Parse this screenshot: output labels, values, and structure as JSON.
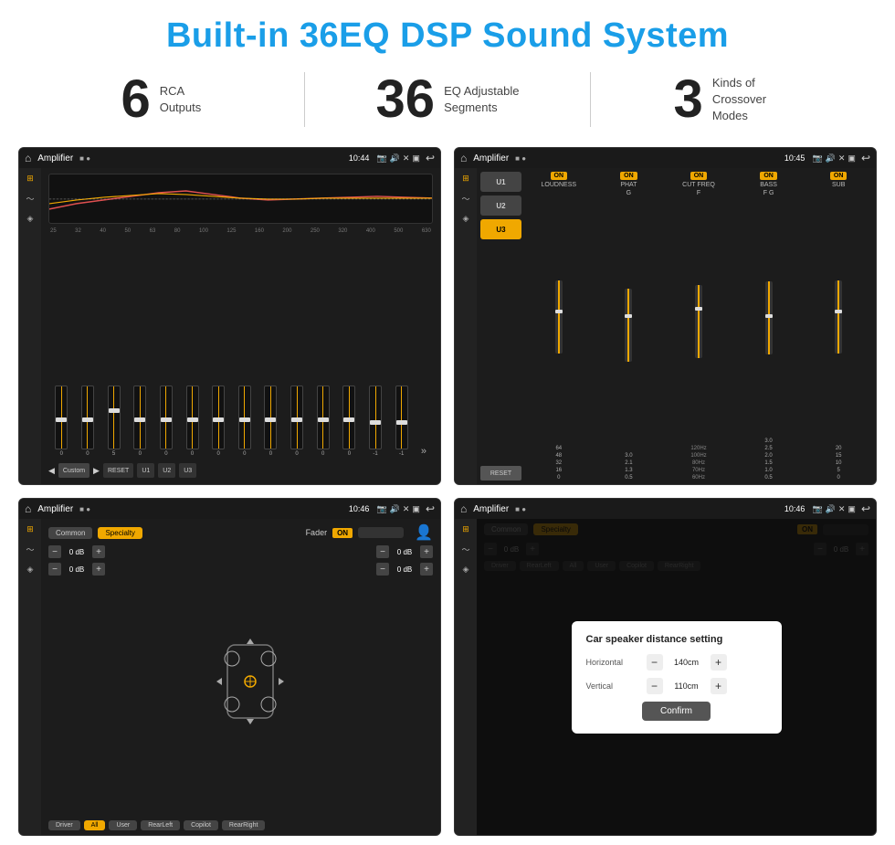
{
  "page": {
    "title": "Built-in 36EQ DSP Sound System",
    "stats": [
      {
        "number": "6",
        "label": "RCA\nOutputs"
      },
      {
        "number": "36",
        "label": "EQ Adjustable\nSegments"
      },
      {
        "number": "3",
        "label": "Kinds of\nCrossover Modes"
      }
    ]
  },
  "screen1": {
    "status_bar": {
      "app": "Amplifier",
      "time": "10:44"
    },
    "eq": {
      "freqs": [
        "25",
        "32",
        "40",
        "50",
        "63",
        "80",
        "100",
        "125",
        "160",
        "200",
        "250",
        "320",
        "400",
        "500",
        "630"
      ],
      "sliders": [
        0,
        0,
        5,
        0,
        0,
        0,
        0,
        0,
        0,
        0,
        0,
        0,
        -1,
        -1
      ],
      "preset": "Custom",
      "buttons": [
        "RESET",
        "U1",
        "U2",
        "U3"
      ]
    }
  },
  "screen2": {
    "status_bar": {
      "app": "Amplifier",
      "time": "10:45"
    },
    "crossover": {
      "u_buttons": [
        "U1",
        "U2",
        "U3"
      ],
      "active": "U3",
      "cols": [
        {
          "label": "LOUDNESS",
          "on": true,
          "g_label": ""
        },
        {
          "label": "PHAT",
          "on": true,
          "g_label": "G"
        },
        {
          "label": "CUT FREQ",
          "on": true,
          "g_label": "F"
        },
        {
          "label": "BASS",
          "on": true,
          "g_label": "F G"
        },
        {
          "label": "SUB",
          "on": true,
          "g_label": ""
        }
      ]
    }
  },
  "screen3": {
    "status_bar": {
      "app": "Amplifier",
      "time": "10:46"
    },
    "fader": {
      "tabs": [
        "Common",
        "Specialty"
      ],
      "active_tab": "Specialty",
      "fader_label": "Fader",
      "on": true,
      "volumes": [
        {
          "val": "0 dB"
        },
        {
          "val": "0 dB"
        },
        {
          "val": "0 dB"
        },
        {
          "val": "0 dB"
        }
      ],
      "buttons": [
        "Driver",
        "RearLeft",
        "All",
        "User",
        "Copilot",
        "RearRight"
      ]
    }
  },
  "screen4": {
    "status_bar": {
      "app": "Amplifier",
      "time": "10:46"
    },
    "fader": {
      "tabs": [
        "Common",
        "Specialty"
      ],
      "active_tab": "Specialty",
      "on": true
    },
    "dialog": {
      "title": "Car speaker distance setting",
      "rows": [
        {
          "label": "Horizontal",
          "value": "140cm"
        },
        {
          "label": "Vertical",
          "value": "110cm"
        }
      ],
      "confirm_label": "Confirm"
    },
    "bottom_buttons": [
      "Driver",
      "RearLeft",
      "All",
      "User",
      "Copilot",
      "RearRight"
    ]
  }
}
